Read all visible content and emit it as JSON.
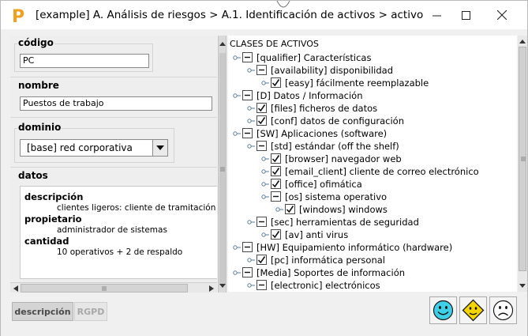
{
  "window": {
    "title": "[example] A. Análisis de riesgos > A.1. Identificación de activos > activo",
    "app_logo_letter": "P",
    "controls": {
      "minimize": "—",
      "close": "✕"
    }
  },
  "form": {
    "codigo": {
      "label": "código",
      "value": "PC"
    },
    "nombre": {
      "label": "nombre",
      "value": "Puestos de trabajo"
    },
    "dominio": {
      "label": "dominio",
      "value": "[base] red corporativa"
    },
    "datos": {
      "label": "datos",
      "rows": [
        {
          "key": "descripción",
          "value": "clientes ligeros: cliente de tramitación + cli"
        },
        {
          "key": "propietario",
          "value": "administrador de sistemas"
        },
        {
          "key": "cantidad",
          "value": "10 operativos + 2 de respaldo"
        }
      ]
    }
  },
  "tree": {
    "root": "CLASES DE ACTIVOS",
    "nodes": [
      {
        "label": "[qualifier] Características",
        "level": 0,
        "state": "minus"
      },
      {
        "label": "[availability] disponibilidad",
        "level": 1,
        "state": "minus"
      },
      {
        "label": "[easy] fácilmente reemplazable",
        "level": 2,
        "state": "check"
      },
      {
        "label": "[D] Datos / Información",
        "level": 0,
        "state": "minus"
      },
      {
        "label": "[files] ficheros de datos",
        "level": 1,
        "state": "check"
      },
      {
        "label": "[conf] datos de configuración",
        "level": 1,
        "state": "check"
      },
      {
        "label": "[SW] Aplicaciones (software)",
        "level": 0,
        "state": "minus"
      },
      {
        "label": "[std] estándar (off the shelf)",
        "level": 1,
        "state": "minus"
      },
      {
        "label": "[browser] navegador web",
        "level": 2,
        "state": "check"
      },
      {
        "label": "[email_client] cliente de correo electrónico",
        "level": 2,
        "state": "check"
      },
      {
        "label": "[office] ofimática",
        "level": 2,
        "state": "check"
      },
      {
        "label": "[os] sistema operativo",
        "level": 2,
        "state": "minus"
      },
      {
        "label": "[windows] windows",
        "level": 3,
        "state": "check"
      },
      {
        "label": "[sec] herramientas de seguridad",
        "level": 1,
        "state": "minus"
      },
      {
        "label": "[av] anti virus",
        "level": 2,
        "state": "check"
      },
      {
        "label": "[HW] Equipamiento informático (hardware)",
        "level": 0,
        "state": "minus"
      },
      {
        "label": "[pc] informática personal",
        "level": 1,
        "state": "check"
      },
      {
        "label": "[Media] Soportes de información",
        "level": 0,
        "state": "minus"
      },
      {
        "label": "[electronic] electrónicos",
        "level": 1,
        "state": "minus"
      }
    ]
  },
  "bottom": {
    "tab_descripcion": "descripción",
    "tab_rgpd": "RGPD",
    "icons": [
      "smiley-happy-icon",
      "warning-smiley-icon",
      "smiley-sad-icon"
    ]
  },
  "colors": {
    "logo_orange": "#f0a020",
    "happy_face": "#3fd0e8",
    "warning_face": "#f5d400"
  }
}
